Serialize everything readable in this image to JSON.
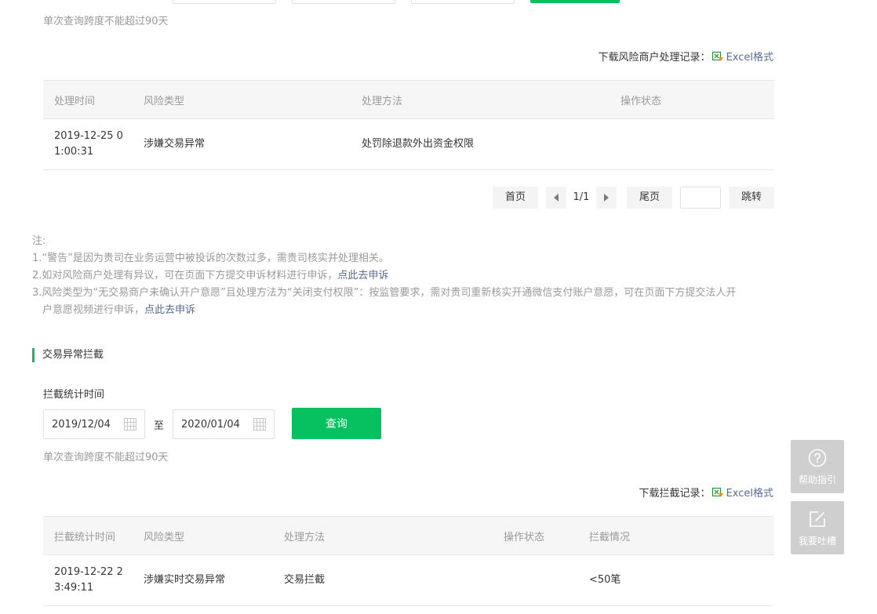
{
  "top_range_hint": "单次查询跨度不能超过90天",
  "risk_section": {
    "download_label": "下载风险商户处理记录：",
    "download_link": "Excel格式",
    "table": {
      "headers": [
        "处理时间",
        "风险类型",
        "处理方法",
        "操作状态"
      ],
      "rows": [
        {
          "time": "2019-12-25 0\n1:00:31",
          "type": "涉嫌交易异常",
          "method": "处罚除退款外出资金权限",
          "status": ""
        }
      ]
    },
    "pager": {
      "first": "首页",
      "page_info": "1/1",
      "last": "尾页",
      "jump_value": "",
      "jump": "跳转"
    }
  },
  "notes": {
    "title": "注:",
    "line1": "1.“警告”是因为贵司在业务运营中被投诉的次数过多，需贵司核实并处理相关。",
    "line2": "2.如对风险商户处理有异议，可在页面下方提交申诉材料进行申诉，",
    "line2_link": "点此去申诉",
    "line3": "3.风险类型为“无交易商户未确认开户意愿”且处理方法为“关闭支付权限”：按监管要求，需对贵司重新核实开通微信支付账户意愿，可在页面下方提交法人开",
    "line3b": "户意愿视频进行申诉，",
    "line3_link": "点此去申诉"
  },
  "intercept_section": {
    "title": "交易异常拦截",
    "date_label": "拦截统计时间",
    "start_date": "2019/12/04",
    "to": "至",
    "end_date": "2020/01/04",
    "query": "查询",
    "range_hint": "单次查询跨度不能超过90天",
    "download_label": "下载拦截记录：",
    "download_link": "Excel格式",
    "table": {
      "headers": [
        "拦截统计时间",
        "风险类型",
        "处理方法",
        "操作状态",
        "拦截情况"
      ],
      "rows": [
        {
          "time": "2019-12-22 2\n3:49:11",
          "type": "涉嫌实时交易异常",
          "method": "交易拦截",
          "status": "",
          "result": "<50笔"
        }
      ]
    }
  },
  "float": {
    "help": "帮助指引",
    "feedback": "我要吐槽"
  },
  "colors": {
    "accent": "#07c160",
    "link": "#576b95",
    "muted": "#9a9a9a"
  }
}
